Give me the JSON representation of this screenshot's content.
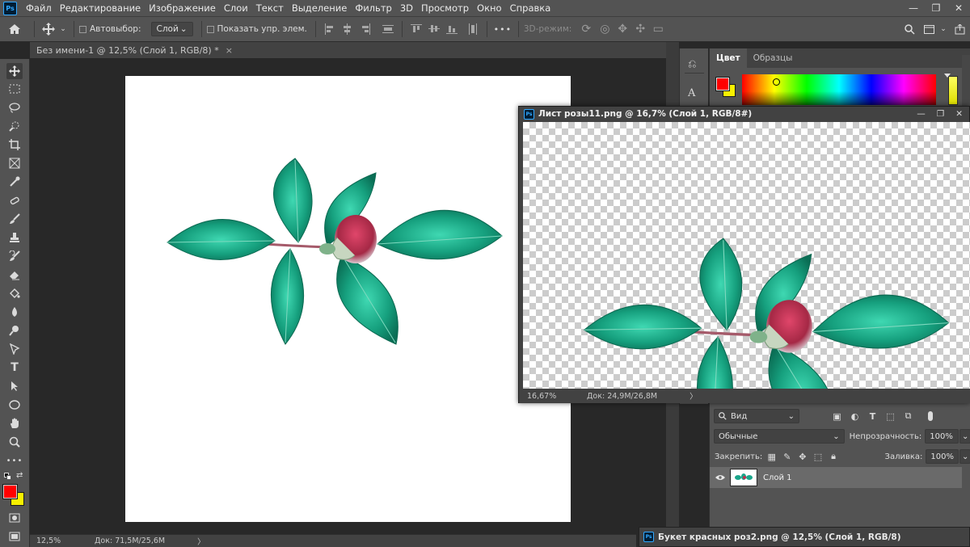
{
  "app": {
    "logo": "Ps",
    "menu": [
      "Файл",
      "Редактирование",
      "Изображение",
      "Слои",
      "Текст",
      "Выделение",
      "Фильтр",
      "3D",
      "Просмотр",
      "Окно",
      "Справка"
    ],
    "window_controls": [
      "—",
      "❐",
      "✕"
    ]
  },
  "options": {
    "autoselect_label": "Автовыбор:",
    "autoselect_value": "Слой",
    "show_transform_label": "Показать упр. элем.",
    "more": "•••",
    "mode3d_label": "3D-режим:"
  },
  "main_doc": {
    "tab_title": "Без имени-1 @ 12,5% (Слой 1, RGB/8) *",
    "close": "×",
    "zoom": "12,5%",
    "doc_info": "Док: 71,5M/25,6M",
    "arrow": "〉"
  },
  "floating_doc": {
    "logo": "Ps",
    "title": "Лист розы11.png @ 16,7% (Слой 1, RGB/8#)",
    "zoom": "16,67%",
    "doc_info": "Док: 24,9M/26,8M",
    "arrow": "〉"
  },
  "bottom_doc": {
    "logo": "Ps",
    "title": "Букет красных роз2.png @ 12,5% (Слой 1, RGB/8)"
  },
  "color_panel": {
    "tabs": [
      "Цвет",
      "Образцы"
    ],
    "foreground": "#ff0000",
    "background": "#f7f000"
  },
  "layers_panel": {
    "filter_label": "Вид",
    "blend_mode": "Обычные",
    "opacity_label": "Непрозрачность:",
    "opacity_value": "100%",
    "lock_label": "Закрепить:",
    "fill_label": "Заливка:",
    "fill_value": "100%",
    "layers": [
      {
        "name": "Слой 1",
        "visible": true
      }
    ]
  },
  "tools": [
    "move",
    "marquee",
    "lasso",
    "quick-select",
    "crop",
    "frame",
    "eyedropper",
    "healing",
    "brush",
    "stamp",
    "history-brush",
    "eraser",
    "gradient",
    "blur",
    "dodge",
    "pen",
    "type",
    "path-select",
    "ellipse",
    "hand",
    "zoom",
    "more"
  ],
  "colors": {
    "ui_panel": "#535353",
    "ui_dark": "#424242",
    "accent_blue": "#31a8ff",
    "leaf": "#1aa58a",
    "bud": "#c0304e"
  }
}
